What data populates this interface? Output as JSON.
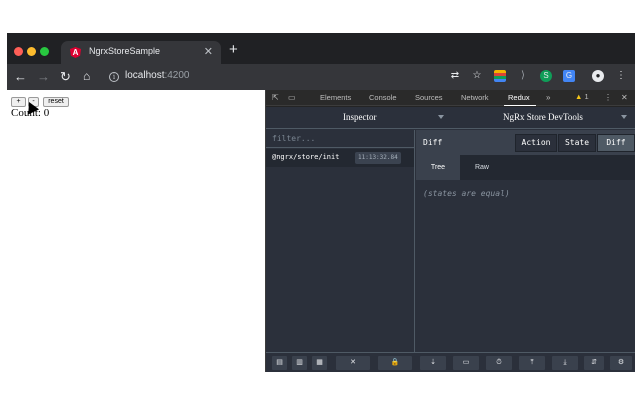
{
  "browser": {
    "tab_title": "NgrxStoreSample",
    "tab_favicon": "A",
    "tab_close": "✕",
    "new_tab": "+",
    "url_host": "localhost",
    "url_port": ":4200",
    "nav_back": "←",
    "nav_forward": "→",
    "nav_reload": "↻",
    "nav_home": "⌂",
    "info": "i",
    "toolbar_icons": {
      "translate": "⇄",
      "star": "☆",
      "ext2": "⟩",
      "ext3": "S",
      "ext4": "G",
      "avatar": "●",
      "menu": "⋮"
    }
  },
  "app": {
    "increment_label": "+",
    "decrement_label": "-",
    "reset_label": "reset",
    "count_text": "Count: 0"
  },
  "devtools": {
    "tabs": [
      "Elements",
      "Console",
      "Sources",
      "Network",
      "Redux"
    ],
    "active_tab": "Redux",
    "more": "»",
    "warning_count": "1",
    "warning_icon": "▲",
    "kebab": "⋮",
    "close": "✕",
    "inspect_icon": "⇱",
    "device_icon": "▭"
  },
  "redux": {
    "monitor_label": "Inspector",
    "instance_label": "NgRx Store DevTools",
    "filter_placeholder": "filter...",
    "actions": [
      {
        "name": "@ngrx/store/init",
        "time": "11:13:32.84"
      }
    ],
    "diff_label": "Diff",
    "segments": [
      "Action",
      "State",
      "Diff"
    ],
    "active_segment": "Diff",
    "subtabs": [
      "Tree",
      "Raw"
    ],
    "active_subtab": "Tree",
    "body_message": "(states are equal)",
    "bottom_buttons": [
      "▤",
      "▥",
      "▦",
      "✕",
      "🔒",
      "⇣",
      "▭",
      "⏱",
      "⤒",
      "⤓",
      "⇵",
      "⚙"
    ]
  }
}
